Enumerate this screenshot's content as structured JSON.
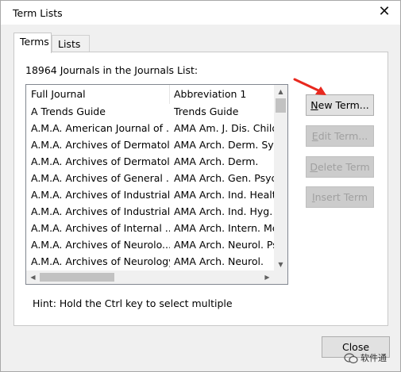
{
  "window": {
    "title": "Term Lists",
    "close_glyph": "✕"
  },
  "tabs": [
    {
      "label": "Terms",
      "active": true
    },
    {
      "label": "Lists",
      "active": false
    }
  ],
  "journals_count_label": "18964 Journals in the Journals List:",
  "table": {
    "columns": [
      "Full Journal",
      "Abbreviation 1"
    ],
    "rows": [
      [
        "A Trends Guide",
        "Trends Guide"
      ],
      [
        "A.M.A. American Journal of ...",
        "AMA Am. J. Dis. Child"
      ],
      [
        "A.M.A. Archives of Dermatol...",
        "AMA Arch. Derm. Syp"
      ],
      [
        "A.M.A. Archives of Dermatol...",
        "AMA Arch. Derm."
      ],
      [
        "A.M.A. Archives of General ...",
        "AMA Arch. Gen. Psych"
      ],
      [
        "A.M.A. Archives of Industrial...",
        "AMA Arch. Ind. Health"
      ],
      [
        "A.M.A. Archives of Industrial...",
        "AMA Arch. Ind. Hyg. C"
      ],
      [
        "A.M.A. Archives of Internal ...",
        "AMA Arch. Intern. Me"
      ],
      [
        "A.M.A. Archives of Neurolo...",
        "AMA Arch. Neurol. Ps"
      ],
      [
        "A.M.A. Archives of Neurology",
        "AMA Arch. Neurol."
      ]
    ]
  },
  "buttons": {
    "new_term": {
      "accel": "N",
      "rest": "ew Term...",
      "enabled": true
    },
    "edit_term": {
      "accel": "E",
      "rest": "dit Term...",
      "enabled": false
    },
    "delete_term": {
      "accel": "D",
      "rest": "elete Term",
      "enabled": false
    },
    "insert_term": {
      "accel": "I",
      "rest": "nsert Term",
      "enabled": false
    }
  },
  "hint": "Hint: Hold the Ctrl key to select multiple",
  "close_button": "Close",
  "watermark": "软件通",
  "colors": {
    "annotation_arrow": "#e8281e",
    "disabled_text": "#a0a0a0",
    "titlebar_bg": "#ffffff"
  }
}
